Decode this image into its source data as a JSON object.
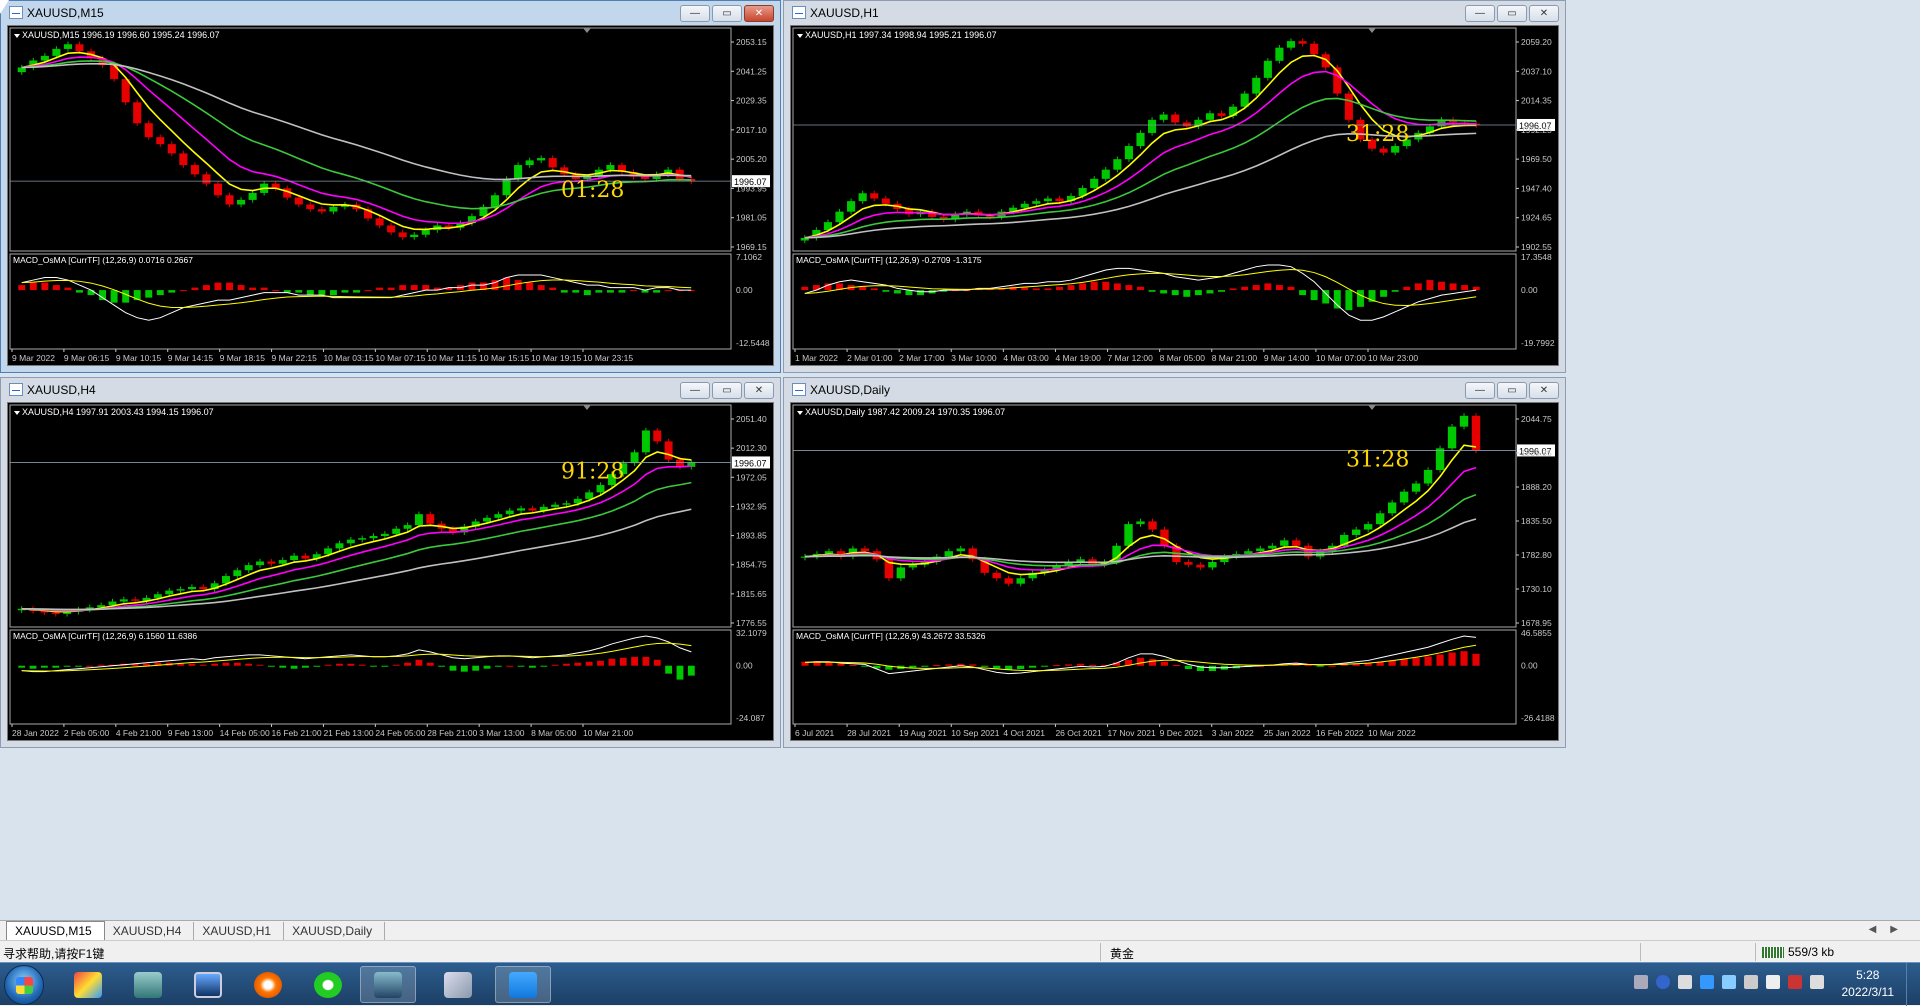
{
  "colors": {
    "bull": "#00c800",
    "bear": "#e60000",
    "yellow": "#ffff00",
    "magenta": "#ff00ff",
    "green": "#3cc83c",
    "gray": "#c0c0c0",
    "macdLine": "#ffffff",
    "signal": "#ffff00",
    "scale": "#c8c8c8",
    "timer": "#ffd700"
  },
  "charts": [
    {
      "id": "m15",
      "title": "XAUUSD,M15",
      "active": true,
      "header": "XAUUSD,M15  1996.19 1996.60 1995.24 1996.07",
      "price_label": "1996.07",
      "timer": "01:28",
      "macd_header": "MACD_OsMA [CurrTF] (12,26,9) 0.0716 0.2667",
      "price_ticks": [
        "2053.15",
        "2041.25",
        "2029.35",
        "2017.10",
        "2005.20",
        "1993.95",
        "1981.05",
        "1969.15"
      ],
      "macd_ticks": [
        "7.1062",
        "0.00",
        "-12.5448"
      ],
      "x_ticks": [
        "9 Mar 2022",
        "9 Mar 06:15",
        "9 Mar 10:15",
        "9 Mar 14:15",
        "9 Mar 18:15",
        "9 Mar 22:15",
        "10 Mar 03:15",
        "10 Mar 07:15",
        "10 Mar 11:15",
        "10 Mar 15:15",
        "10 Mar 19:15",
        "10 Mar 23:15"
      ],
      "chart_data": {
        "type": "line",
        "pmin": 1966,
        "pmax": 2062,
        "last": 1996.07,
        "close": [
          2045,
          2048,
          2050,
          2053,
          2055,
          2052,
          2049,
          2046,
          2040,
          2030,
          2021,
          2015,
          2012,
          2008,
          2003,
          1999,
          1995,
          1990,
          1986,
          1988,
          1991,
          1995,
          1993,
          1989,
          1986,
          1984,
          1983,
          1985,
          1986,
          1984,
          1980,
          1977,
          1974,
          1972,
          1973,
          1975,
          1977,
          1976,
          1978,
          1981,
          1985,
          1990,
          1997,
          2003,
          2005,
          2006,
          2002,
          1999,
          1997,
          1998,
          2001,
          2003,
          2000,
          1998,
          1997,
          1999,
          2001,
          1997,
          1996
        ],
        "macd_line": [
          3,
          4,
          5,
          5,
          4,
          2,
          0,
          -3,
          -6,
          -9,
          -11,
          -12,
          -11,
          -9,
          -7,
          -6,
          -5,
          -4,
          -4,
          -3,
          -2,
          -1,
          -1,
          -1,
          -2,
          -2,
          -2,
          -3,
          -3,
          -3,
          -3,
          -3,
          -3,
          -2,
          -1,
          0,
          0,
          1,
          1,
          2,
          2,
          3,
          5,
          6,
          6,
          6,
          5,
          4,
          3,
          2,
          2,
          1,
          1,
          1,
          0,
          1,
          1,
          0,
          0
        ],
        "hist": [
          2,
          3,
          3,
          2,
          1,
          -1,
          -2,
          -4,
          -5,
          -5,
          -4,
          -3,
          -2,
          -1,
          0,
          1,
          2,
          3,
          3,
          2,
          1,
          1,
          0,
          -1,
          -1,
          -2,
          -2,
          -2,
          -1,
          -1,
          0,
          1,
          1,
          2,
          2,
          2,
          1,
          1,
          2,
          3,
          3,
          4,
          5,
          4,
          3,
          2,
          1,
          -1,
          -1,
          -2,
          -1,
          -1,
          -1,
          0,
          -1,
          -1,
          0,
          0,
          0
        ]
      }
    },
    {
      "id": "h1",
      "title": "XAUUSD,H1",
      "active": false,
      "header": "XAUUSD,H1  1997.34 1998.94 1995.21 1996.07",
      "price_label": "1996.07",
      "timer": "31:28",
      "macd_header": "MACD_OsMA [CurrTF] (12,26,9) -0.2709 -1.3175",
      "price_ticks": [
        "2059.20",
        "2037.10",
        "2014.35",
        "1992.25",
        "1969.50",
        "1947.40",
        "1924.65",
        "1902.55"
      ],
      "macd_ticks": [
        "17.3548",
        "0.00",
        "-19.7992"
      ],
      "x_ticks": [
        "1 Mar 2022",
        "2 Mar 01:00",
        "2 Mar 17:00",
        "3 Mar 10:00",
        "4 Mar 03:00",
        "4 Mar 19:00",
        "7 Mar 12:00",
        "8 Mar 05:00",
        "8 Mar 21:00",
        "9 Mar 14:00",
        "10 Mar 07:00",
        "10 Mar 23:00"
      ],
      "chart_data": {
        "type": "line",
        "pmin": 1900,
        "pmax": 2070,
        "last": 1996.07,
        "close": [
          1910,
          1916,
          1922,
          1930,
          1938,
          1944,
          1940,
          1936,
          1932,
          1928,
          1930,
          1926,
          1924,
          1928,
          1930,
          1927,
          1926,
          1930,
          1933,
          1936,
          1938,
          1940,
          1938,
          1942,
          1948,
          1955,
          1962,
          1970,
          1980,
          1990,
          2000,
          2004,
          1998,
          1995,
          2000,
          2005,
          2003,
          2010,
          2020,
          2032,
          2045,
          2055,
          2060,
          2058,
          2050,
          2040,
          2020,
          2000,
          1985,
          1978,
          1975,
          1980,
          1985,
          1990,
          1995,
          2000,
          1998,
          1997,
          1996
        ],
        "macd_line": [
          -2,
          0,
          3,
          5,
          6,
          5,
          4,
          3,
          1,
          0,
          -1,
          -1,
          0,
          0,
          0,
          1,
          1,
          2,
          3,
          4,
          4,
          5,
          5,
          6,
          8,
          10,
          12,
          13,
          13,
          12,
          11,
          10,
          8,
          7,
          6,
          7,
          8,
          10,
          12,
          14,
          15,
          15,
          14,
          10,
          5,
          -2,
          -9,
          -15,
          -18,
          -18,
          -16,
          -13,
          -10,
          -7,
          -5,
          -3,
          -2,
          -1,
          0
        ],
        "hist": [
          2,
          3,
          4,
          4,
          3,
          2,
          1,
          -1,
          -2,
          -3,
          -3,
          -2,
          -1,
          0,
          0,
          1,
          1,
          1,
          2,
          2,
          1,
          1,
          2,
          3,
          4,
          5,
          5,
          4,
          3,
          2,
          -1,
          -2,
          -3,
          -4,
          -3,
          -2,
          -1,
          1,
          2,
          3,
          4,
          3,
          2,
          -3,
          -6,
          -8,
          -11,
          -12,
          -10,
          -7,
          -4,
          -1,
          2,
          4,
          6,
          5,
          4,
          3,
          2
        ]
      }
    },
    {
      "id": "h4",
      "title": "XAUUSD,H4",
      "active": false,
      "header": "XAUUSD,H4  1997.91 2003.43 1994.15 1996.07",
      "price_label": "1996.07",
      "timer": "91:28",
      "macd_header": "MACD_OsMA [CurrTF] (12,26,9) 6.1560 11.6386",
      "price_ticks": [
        "2051.40",
        "2012.30",
        "1972.05",
        "1932.95",
        "1893.85",
        "1854.75",
        "1815.65",
        "1776.55"
      ],
      "macd_ticks": [
        "32.1079",
        "0.00",
        "-24.087"
      ],
      "x_ticks": [
        "28 Jan 2022",
        "2 Feb 05:00",
        "4 Feb 21:00",
        "9 Feb 13:00",
        "14 Feb 05:00",
        "16 Feb 21:00",
        "21 Feb 13:00",
        "24 Feb 05:00",
        "28 Feb 21:00",
        "3 Mar 13:00",
        "8 Mar 05:00",
        "10 Mar 21:00"
      ],
      "chart_data": {
        "type": "line",
        "pmin": 1770,
        "pmax": 2075,
        "last": 1996.07,
        "close": [
          1795,
          1792,
          1790,
          1788,
          1791,
          1794,
          1797,
          1800,
          1805,
          1808,
          1806,
          1810,
          1815,
          1820,
          1822,
          1825,
          1822,
          1830,
          1840,
          1848,
          1855,
          1860,
          1857,
          1862,
          1868,
          1864,
          1870,
          1878,
          1885,
          1890,
          1892,
          1895,
          1898,
          1905,
          1910,
          1925,
          1912,
          1905,
          1900,
          1908,
          1915,
          1920,
          1925,
          1930,
          1933,
          1930,
          1935,
          1938,
          1940,
          1946,
          1955,
          1965,
          1980,
          1995,
          2010,
          2040,
          2025,
          2000,
          1990,
          1996
        ],
        "macd_line": [
          -5,
          -6,
          -6,
          -5,
          -4,
          -3,
          -2,
          -1,
          0,
          1,
          2,
          3,
          4,
          5,
          6,
          7,
          6,
          8,
          9,
          10,
          11,
          11,
          10,
          9,
          8,
          7,
          8,
          9,
          10,
          11,
          10,
          9,
          9,
          10,
          12,
          16,
          14,
          11,
          8,
          7,
          8,
          9,
          10,
          10,
          9,
          8,
          9,
          10,
          11,
          13,
          15,
          18,
          22,
          25,
          28,
          30,
          28,
          24,
          18,
          14
        ],
        "hist": [
          -2,
          -3,
          -2,
          -2,
          -1,
          -1,
          0,
          1,
          1,
          2,
          2,
          2,
          3,
          3,
          2,
          2,
          1,
          2,
          3,
          3,
          2,
          1,
          -1,
          -2,
          -3,
          -2,
          -1,
          1,
          2,
          2,
          1,
          -1,
          -1,
          1,
          3,
          6,
          3,
          -1,
          -5,
          -6,
          -5,
          -3,
          -1,
          0,
          -1,
          -2,
          -1,
          1,
          2,
          3,
          4,
          5,
          7,
          8,
          9,
          9,
          6,
          -8,
          -14,
          -10
        ]
      }
    },
    {
      "id": "d1",
      "title": "XAUUSD,Daily",
      "active": false,
      "header": "XAUUSD,Daily  1987.42 2009.24 1970.35 1996.07",
      "price_label": "1996.07",
      "timer": "31:28",
      "macd_header": "MACD_OsMA [CurrTF] (12,26,9) 43.2672 33.5326",
      "price_ticks": [
        "2044.75",
        "1939.35",
        "1888.20",
        "1835.50",
        "1782.80",
        "1730.10",
        "1678.95"
      ],
      "macd_ticks": [
        "46.5855",
        "0.00",
        "-26.4188"
      ],
      "x_ticks": [
        "6 Jul 2021",
        "28 Jul 2021",
        "19 Aug 2021",
        "10 Sep 2021",
        "4 Oct 2021",
        "26 Oct 2021",
        "17 Nov 2021",
        "9 Dec 2021",
        "3 Jan 2022",
        "25 Jan 2022",
        "16 Feb 2022",
        "10 Mar 2022"
      ],
      "chart_data": {
        "type": "line",
        "pmin": 1670,
        "pmax": 2080,
        "last": 1996.07,
        "close": [
          1800,
          1805,
          1810,
          1800,
          1815,
          1810,
          1795,
          1760,
          1780,
          1785,
          1790,
          1800,
          1810,
          1815,
          1795,
          1770,
          1760,
          1750,
          1760,
          1770,
          1775,
          1782,
          1790,
          1795,
          1785,
          1790,
          1820,
          1860,
          1865,
          1850,
          1820,
          1790,
          1785,
          1780,
          1790,
          1800,
          1805,
          1810,
          1815,
          1820,
          1830,
          1820,
          1800,
          1810,
          1820,
          1840,
          1850,
          1860,
          1880,
          1900,
          1920,
          1935,
          1960,
          2000,
          2040,
          2060,
          1996
        ],
        "macd_line": [
          5,
          6,
          6,
          4,
          3,
          2,
          -5,
          -12,
          -10,
          -8,
          -6,
          -4,
          -2,
          0,
          -2,
          -6,
          -10,
          -12,
          -11,
          -9,
          -7,
          -5,
          -3,
          -1,
          -2,
          -1,
          4,
          12,
          18,
          18,
          14,
          8,
          2,
          -2,
          -3,
          -3,
          -2,
          -1,
          0,
          1,
          3,
          4,
          2,
          1,
          2,
          4,
          6,
          8,
          12,
          16,
          20,
          24,
          28,
          34,
          40,
          45,
          43
        ],
        "hist": [
          6,
          7,
          5,
          3,
          1,
          -1,
          -4,
          -6,
          -5,
          -3,
          -1,
          1,
          2,
          3,
          2,
          -1,
          -4,
          -6,
          -5,
          -3,
          -1,
          1,
          2,
          3,
          1,
          1,
          5,
          9,
          12,
          10,
          6,
          1,
          -5,
          -8,
          -8,
          -6,
          -4,
          -2,
          0,
          1,
          2,
          3,
          1,
          -1,
          0,
          2,
          3,
          4,
          6,
          8,
          10,
          12,
          14,
          17,
          20,
          22,
          18
        ]
      }
    }
  ],
  "tabs": [
    "XAUUSD,M15",
    "XAUUSD,H4",
    "XAUUSD,H1",
    "XAUUSD,Daily"
  ],
  "status": {
    "help": "寻求帮助,请按F1键",
    "symbol": "黄金",
    "traffic": "559/3 kb"
  },
  "taskbar": {
    "time": "5:28",
    "date": "2022/3/11"
  }
}
